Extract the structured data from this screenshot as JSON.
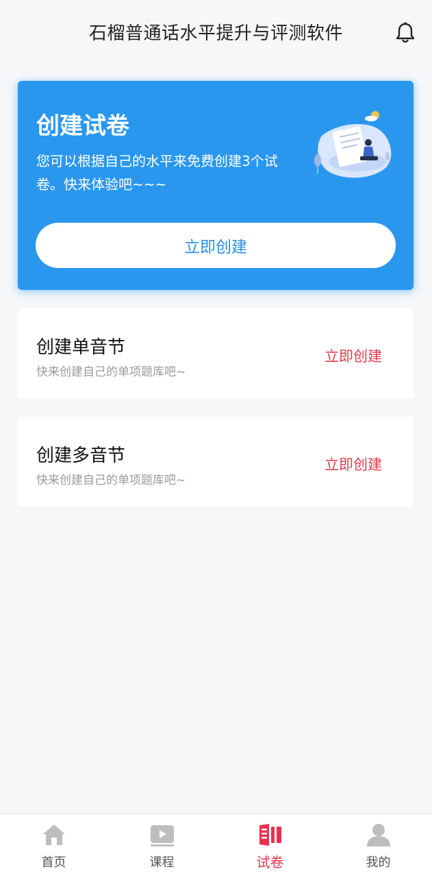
{
  "header": {
    "title": "石榴普通话水平提升与评测软件"
  },
  "hero": {
    "title": "创建试卷",
    "description": "您可以根据自己的水平来免费创建3个试卷。快来体验吧~~~",
    "button_label": "立即创建",
    "color": "#2a97ef"
  },
  "cards": [
    {
      "title": "创建单音节",
      "subtitle": "快来创建自己的单项题库吧~",
      "action": "立即创建"
    },
    {
      "title": "创建多音节",
      "subtitle": "快来创建自己的单项题库吧~",
      "action": "立即创建"
    }
  ],
  "tabbar": {
    "active_index": 2,
    "active_color": "#e8324f",
    "items": [
      {
        "label": "首页",
        "icon": "home-icon"
      },
      {
        "label": "课程",
        "icon": "video-play-icon"
      },
      {
        "label": "试卷",
        "icon": "paper-icon"
      },
      {
        "label": "我的",
        "icon": "user-icon"
      }
    ]
  }
}
